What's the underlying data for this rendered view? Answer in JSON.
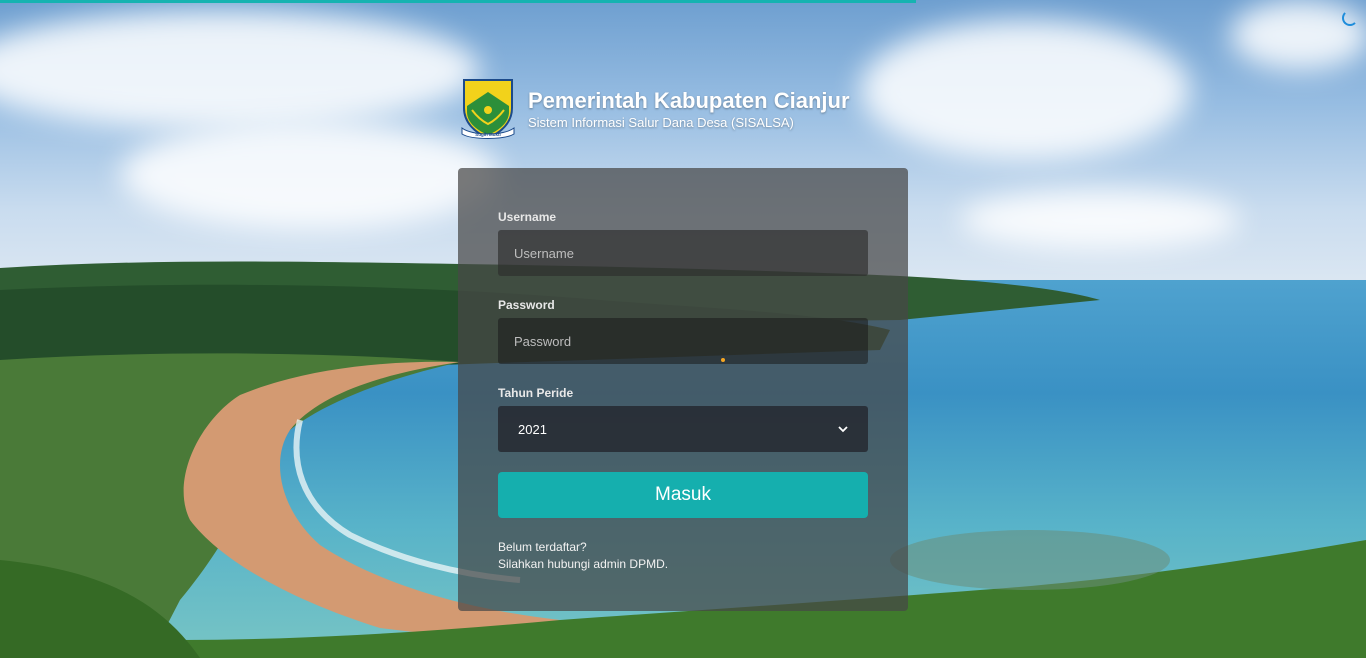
{
  "header": {
    "title": "Pemerintah Kabupaten Cianjur",
    "subtitle": "Sistem Informasi Salur Dana Desa (SISALSA)",
    "logo_icon": "cianjur-regency-emblem",
    "logo_text": "Sugih Mukti"
  },
  "form": {
    "username_label": "Username",
    "username_placeholder": "Username",
    "username_value": "",
    "password_label": "Password",
    "password_placeholder": "Password",
    "password_value": "",
    "year_label": "Tahun Peride",
    "year_selected": "2021",
    "submit_label": "Masuk",
    "note_line1": "Belum terdaftar?",
    "note_line2": "Silahkan hubungi admin DPMD."
  },
  "colors": {
    "accent": "#15afae",
    "progress": "#16b3b1",
    "card_bg": "rgba(70,70,70,0.72)"
  },
  "icons": {
    "select_arrow": "chevron-down-icon",
    "loading": "spinner-icon"
  }
}
